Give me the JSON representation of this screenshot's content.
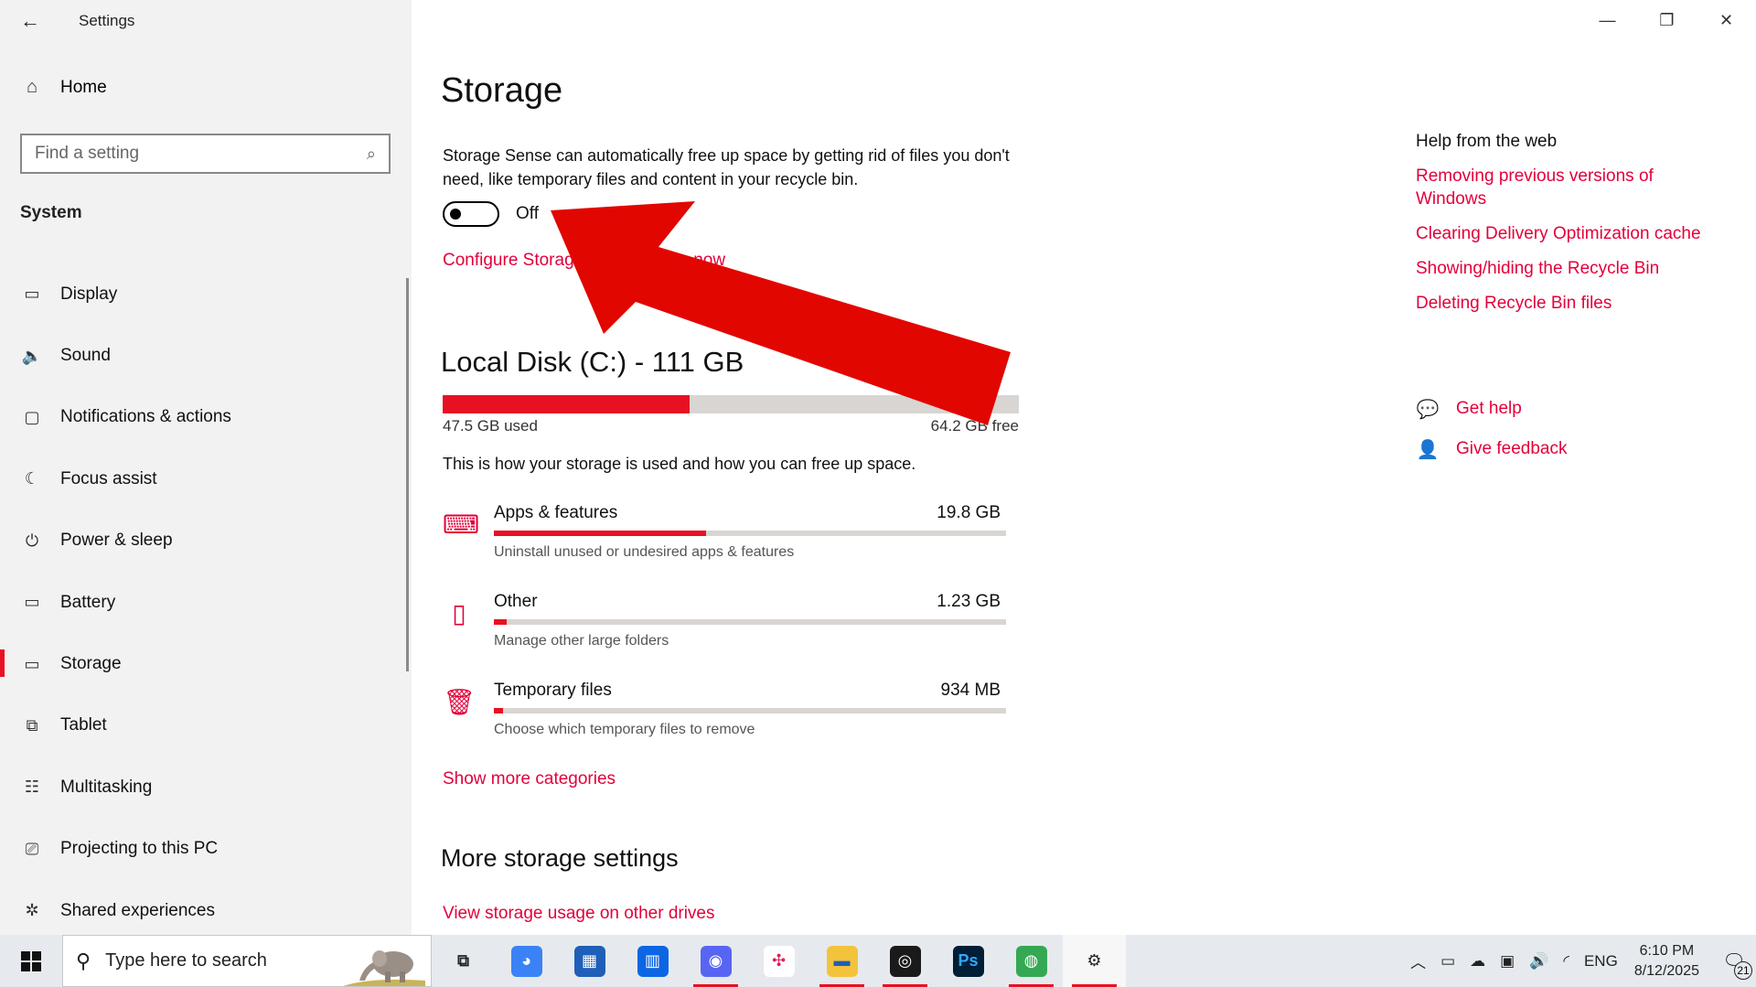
{
  "window": {
    "title": "Settings",
    "controls": {
      "minimize": "—",
      "restore": "❐",
      "close": "✕"
    }
  },
  "sidebar": {
    "home_label": "Home",
    "search_placeholder": "Find a setting",
    "section": "System",
    "items": [
      {
        "label": "Display",
        "icon": "monitor-icon",
        "glyph": "▭"
      },
      {
        "label": "Sound",
        "icon": "speaker-icon",
        "glyph": "🔈"
      },
      {
        "label": "Notifications & actions",
        "icon": "notification-icon",
        "glyph": "▢"
      },
      {
        "label": "Focus assist",
        "icon": "moon-icon",
        "glyph": "☾"
      },
      {
        "label": "Power & sleep",
        "icon": "power-icon",
        "glyph": "⏻"
      },
      {
        "label": "Battery",
        "icon": "battery-icon",
        "glyph": "▭"
      },
      {
        "label": "Storage",
        "icon": "storage-icon",
        "glyph": "▭",
        "active": true
      },
      {
        "label": "Tablet",
        "icon": "tablet-icon",
        "glyph": "⧉"
      },
      {
        "label": "Multitasking",
        "icon": "multitasking-icon",
        "glyph": "☷"
      },
      {
        "label": "Projecting to this PC",
        "icon": "projecting-icon",
        "glyph": "⎚"
      },
      {
        "label": "Shared experiences",
        "icon": "shared-icon",
        "glyph": "✲"
      }
    ]
  },
  "main": {
    "title": "Storage",
    "sense_description": "Storage Sense can automatically free up space by getting rid of files you don't need, like temporary files and content in your recycle bin.",
    "toggle_state": "Off",
    "configure_link": "Configure Storage",
    "run_now_link": "now",
    "disk": {
      "title": "Local Disk (C:) - 111 GB",
      "used_label": "47.5 GB used",
      "free_label": "64.2 GB free",
      "used_fraction": 0.428
    },
    "usage_description": "This is how your storage is used and how you can free up space.",
    "categories": [
      {
        "name": "Apps & features",
        "size": "19.8 GB",
        "subtitle": "Uninstall unused or undesired apps & features",
        "fraction": 0.415,
        "icon": "keyboard-icon"
      },
      {
        "name": "Other",
        "size": "1.23 GB",
        "subtitle": "Manage other large folders",
        "fraction": 0.025,
        "icon": "folder-icon"
      },
      {
        "name": "Temporary files",
        "size": "934 MB",
        "subtitle": "Choose which temporary files to remove",
        "fraction": 0.018,
        "icon": "trash-icon"
      }
    ],
    "show_more": "Show more categories",
    "more_title": "More storage settings",
    "view_other": "View storage usage on other drives"
  },
  "help": {
    "title": "Help from the web",
    "links": [
      "Removing previous versions of Windows",
      "Clearing Delivery Optimization cache",
      "Showing/hiding the Recycle Bin",
      "Deleting Recycle Bin files"
    ],
    "get_help": "Get help",
    "give_feedback": "Give feedback"
  },
  "taskbar": {
    "search_placeholder": "Type here to search",
    "apps": [
      {
        "name": "task-view-icon",
        "glyph": "⧉",
        "color": "transparent",
        "fg": "#222"
      },
      {
        "name": "copilot-icon",
        "glyph": "◕",
        "color": "#3b82f6",
        "fg": "#fff"
      },
      {
        "name": "microsoft-store-icon",
        "glyph": "▦",
        "color": "#1f5fb8",
        "fg": "#fff"
      },
      {
        "name": "trello-icon",
        "glyph": "▥",
        "color": "#0c66e4",
        "fg": "#fff"
      },
      {
        "name": "discord-icon",
        "glyph": "◉",
        "color": "#5865f2",
        "fg": "#fff",
        "running": true
      },
      {
        "name": "slack-icon",
        "glyph": "✣",
        "color": "#ffffff",
        "fg": "#e01e5a"
      },
      {
        "name": "file-explorer-icon",
        "glyph": "▬",
        "color": "#f3c33c",
        "fg": "#1f5fb8",
        "running": true
      },
      {
        "name": "obs-icon",
        "glyph": "◎",
        "color": "#1a1a1a",
        "fg": "#fff",
        "running": true
      },
      {
        "name": "photoshop-icon",
        "glyph": "Ps",
        "color": "#001e36",
        "fg": "#31a8ff"
      },
      {
        "name": "chrome-icon",
        "glyph": "◍",
        "color": "#34a853",
        "fg": "#fff",
        "running": true
      },
      {
        "name": "settings-icon",
        "glyph": "⚙",
        "color": "transparent",
        "fg": "#222",
        "running": true,
        "active": true
      }
    ],
    "language": "ENG",
    "time": "6:10 PM",
    "date": "8/12/2025",
    "notification_count": "21"
  },
  "colors": {
    "accent": "#e81123",
    "link": "#e3003a",
    "arrow": "#e10600"
  }
}
